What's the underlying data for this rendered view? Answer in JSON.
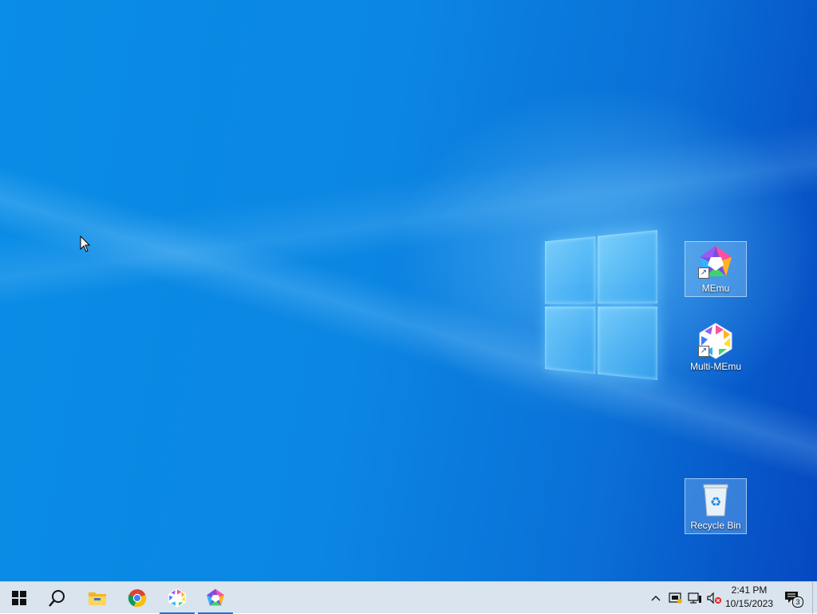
{
  "desktop": {
    "icons": [
      {
        "label": "MEmu",
        "icon": "memu-icon",
        "shortcut": true,
        "selected": true
      },
      {
        "label": "Multi-MEmu",
        "icon": "multi-memu-icon",
        "shortcut": true,
        "selected": false
      },
      {
        "label": "Recycle Bin",
        "icon": "recycle-bin-icon",
        "shortcut": false,
        "selected": true
      }
    ]
  },
  "taskbar": {
    "buttons": [
      {
        "name": "start",
        "icon": "windows-logo-icon"
      },
      {
        "name": "search",
        "icon": "search-icon"
      },
      {
        "name": "file-explorer",
        "icon": "folder-icon"
      },
      {
        "name": "chrome",
        "icon": "chrome-icon"
      },
      {
        "name": "multi-memu",
        "icon": "multi-memu-icon",
        "active": true
      },
      {
        "name": "memu",
        "icon": "memu-icon",
        "active": true
      }
    ],
    "tray": {
      "chevron": "^",
      "notification_count": "3"
    },
    "clock": {
      "time": "2:41 PM",
      "date": "10/15/2023"
    }
  },
  "colors": {
    "wallpaper_blue": "#0a86e2",
    "taskbar_bg": "#d9e4ee",
    "active_indicator": "#1f74d1"
  }
}
